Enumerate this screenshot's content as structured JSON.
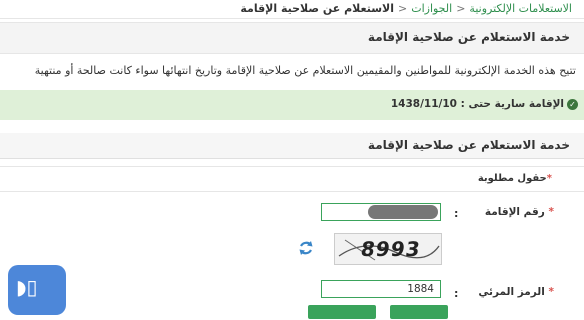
{
  "breadcrumb": {
    "items": [
      "الاستعلامات الإلكترونية",
      "الجوازات",
      "الاستعلام عن صلاحية الإقامة"
    ]
  },
  "page_header": {
    "title": "خدمة الاستعلام عن صلاحية الإقامة"
  },
  "description": "تتيح هذه الخدمة الإلكترونية للمواطنين والمقيمين الاستعلام عن صلاحية الإقامة وتاريخ انتهائها سواء كانت صالحة أو منتهية",
  "status_alert": {
    "text": "الإقامة سارية حتى : 1438/11/10",
    "color": "#dff0d8"
  },
  "panel": {
    "title": "خدمة الاستعلام عن صلاحية الإقامة",
    "required_note": "حقول مطلوبة",
    "iqama_label": "رقم الإقامة",
    "colon": ":",
    "captcha_text": "8993",
    "captcha_code_label": "الرمز المرئي",
    "captcha_code_value": "1884"
  },
  "colors": {
    "accent": "#3aa35b",
    "link": "#2f8f4e",
    "required": "#d9534f"
  }
}
